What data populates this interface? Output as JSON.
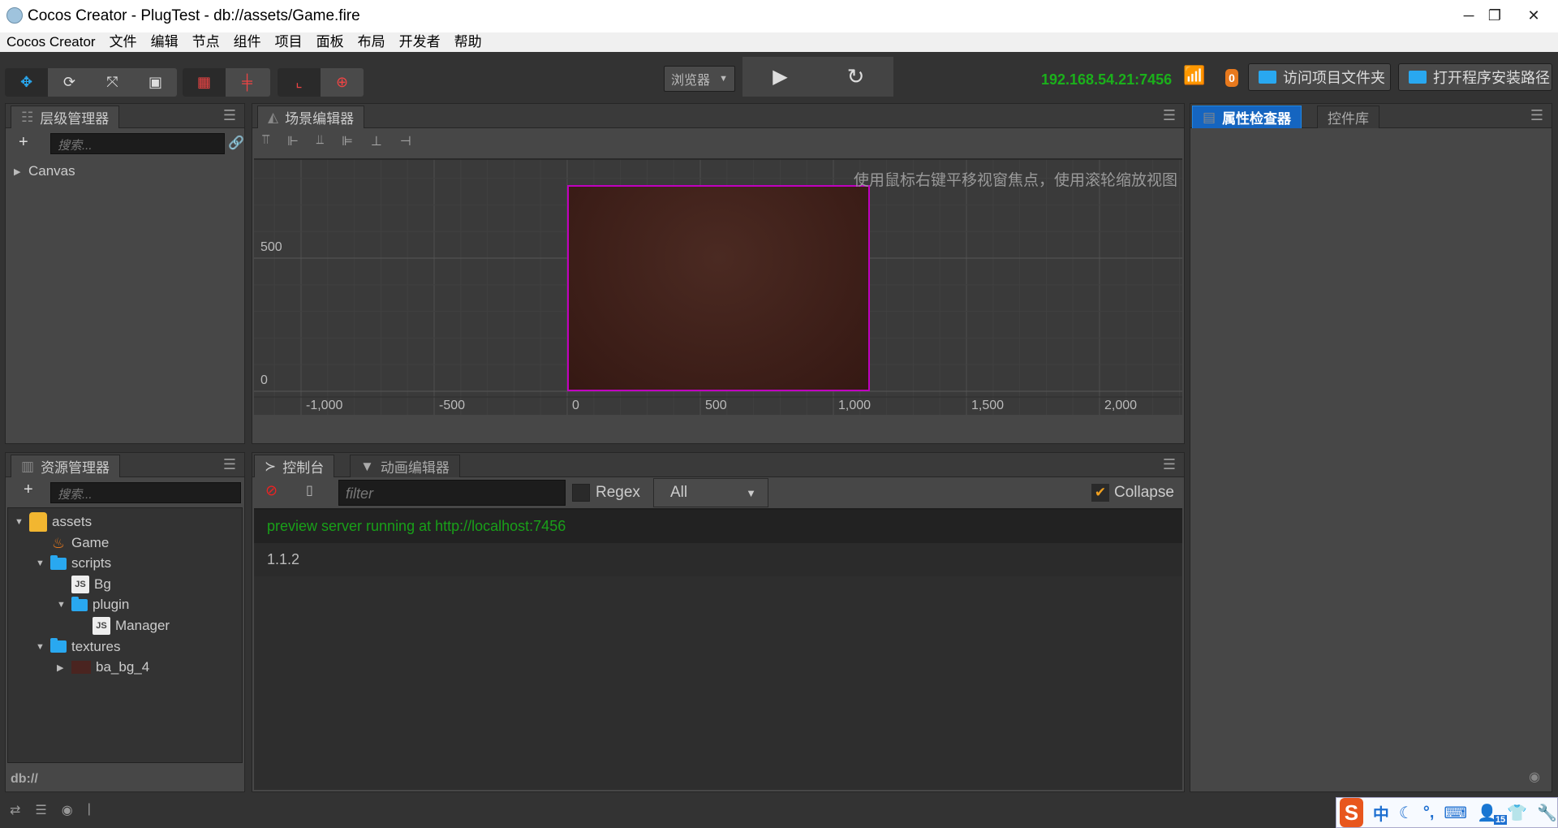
{
  "window": {
    "title": "Cocos Creator - PlugTest - db://assets/Game.fire",
    "controls": [
      "minimize",
      "restore",
      "close"
    ]
  },
  "menu": [
    "Cocos Creator",
    "文件",
    "编辑",
    "节点",
    "组件",
    "项目",
    "面板",
    "布局",
    "开发者",
    "帮助"
  ],
  "toolbar": {
    "transform_tools": [
      "move-icon",
      "rotate-icon",
      "scale-icon",
      "rect-icon"
    ],
    "pivot_tools": [
      "pivot-local-icon",
      "pivot-center-icon"
    ],
    "coord_tools": [
      "local-coords-icon",
      "global-coords-icon"
    ],
    "preview_select": "浏览器",
    "ip": "192.168.54.21:7456",
    "badge_count": "0",
    "open_project_folder": "访问项目文件夹",
    "open_install_path": "打开程序安装路径",
    "colors": {
      "ip": "#1bb01b",
      "badge": "#e8791d",
      "accent": "#1e88e5"
    }
  },
  "hierarchy": {
    "title": "层级管理器",
    "search_placeholder": "搜索...",
    "nodes": [
      {
        "label": "Canvas",
        "expanded": false
      }
    ]
  },
  "scene": {
    "title": "场景编辑器",
    "hint": "使用鼠标右键平移视窗焦点，使用滚轮缩放视图",
    "x_ticks": [
      "-1,000",
      "-500",
      "0",
      "500",
      "1,000",
      "1,500",
      "2,000"
    ],
    "x_tick_values": [
      -1000,
      -500,
      0,
      500,
      1000,
      1500,
      2000
    ],
    "y_ticks": [
      "0",
      "500"
    ],
    "y_tick_values": [
      0,
      500
    ],
    "selection_color": "#c000c0"
  },
  "inspector": {
    "tabs": [
      "属性检查器",
      "控件库"
    ],
    "active": 0
  },
  "assets": {
    "title": "资源管理器",
    "search_placeholder": "搜索...",
    "footer": "db://",
    "items": [
      {
        "label": "assets",
        "type": "root",
        "depth": 0,
        "arrow": "down"
      },
      {
        "label": "Game",
        "type": "scene",
        "depth": 1,
        "arrow": ""
      },
      {
        "label": "scripts",
        "type": "folder",
        "depth": 1,
        "arrow": "down"
      },
      {
        "label": "Bg",
        "type": "js",
        "depth": 2,
        "arrow": ""
      },
      {
        "label": "plugin",
        "type": "folder",
        "depth": 2,
        "arrow": "down"
      },
      {
        "label": "Manager",
        "type": "js",
        "depth": 3,
        "arrow": ""
      },
      {
        "label": "textures",
        "type": "folder",
        "depth": 1,
        "arrow": "down"
      },
      {
        "label": "ba_bg_4",
        "type": "texture",
        "depth": 2,
        "arrow": "right"
      }
    ]
  },
  "console": {
    "tabs": [
      "控制台",
      "动画编辑器"
    ],
    "filter_placeholder": "filter",
    "regex_label": "Regex",
    "regex_checked": false,
    "level_select": "All",
    "collapse_label": "Collapse",
    "collapse_checked": true,
    "logs": [
      {
        "text": "preview server running at http://localhost:7456",
        "color": "#19a019"
      },
      {
        "text": "1.1.2",
        "color": "#bbbbbb"
      }
    ]
  },
  "ime": {
    "label": "中",
    "badge": "15"
  }
}
